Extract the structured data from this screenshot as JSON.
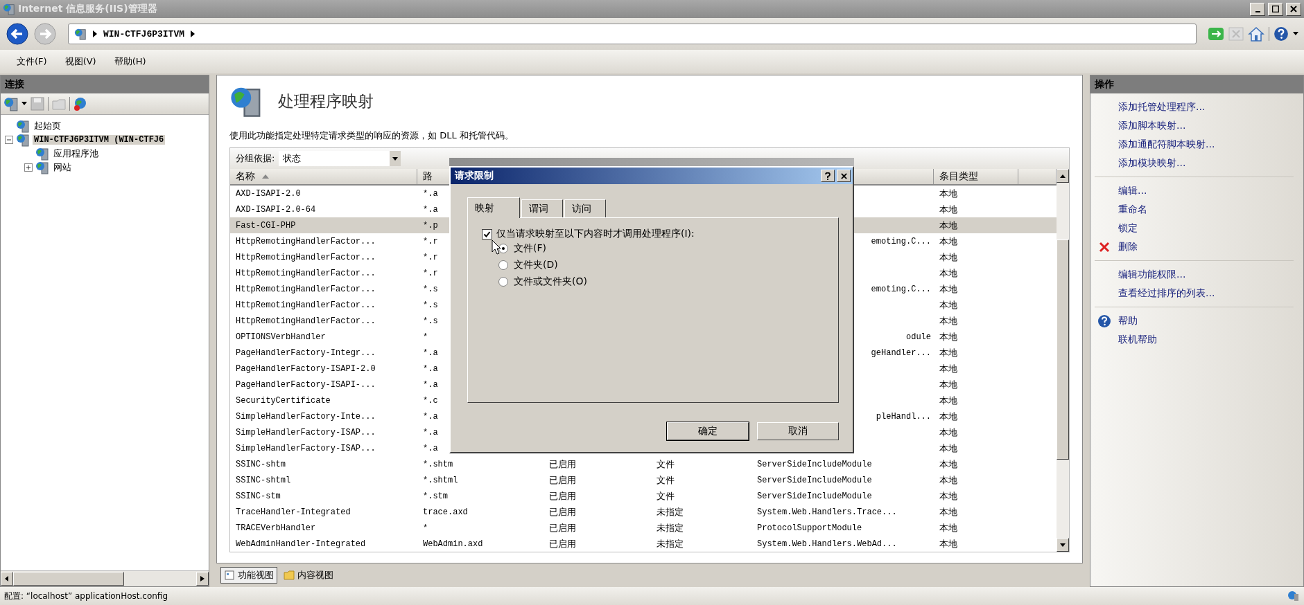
{
  "window": {
    "title": "Internet 信息服务(IIS)管理器"
  },
  "address_bar": {
    "segments": [
      "WIN-CTFJ6P3ITVM"
    ]
  },
  "menu": [
    "文件(F)",
    "视图(V)",
    "帮助(H)"
  ],
  "connections": {
    "title": "连接",
    "tree": [
      {
        "label": "起始页",
        "selected": false
      },
      {
        "label": "WIN-CTFJ6P3ITVM (WIN-CTFJ6",
        "selected": true,
        "expanded": true,
        "children": [
          {
            "label": "应用程序池",
            "selected": false
          },
          {
            "label": "网站",
            "selected": false,
            "expanded": false
          }
        ]
      }
    ]
  },
  "feature": {
    "title": "处理程序映射",
    "description": "使用此功能指定处理特定请求类型的响应的资源，如 DLL 和托管代码。",
    "group_by": {
      "label": "分组依据:",
      "value": "状态"
    }
  },
  "table": {
    "columns": {
      "name": {
        "label": "名称",
        "sorted": true
      },
      "path": {
        "label": "路"
      },
      "entry_type": {
        "label": "条目类型"
      }
    },
    "rows": [
      {
        "kind": "covered",
        "selected": false,
        "name": "AXD-ISAPI-2.0",
        "path": "*.a",
        "entry_type": "本地"
      },
      {
        "kind": "covered",
        "selected": false,
        "name": "AXD-ISAPI-2.0-64",
        "path": "*.a",
        "entry_type": "本地"
      },
      {
        "kind": "covered",
        "selected": true,
        "name": "Fast-CGI-PHP",
        "path": "*.p",
        "entry_type": "本地"
      },
      {
        "kind": "covered",
        "selected": false,
        "name": "HttpRemotingHandlerFactor...",
        "path": "*.r",
        "handler": "emoting.C...",
        "entry_type": "本地"
      },
      {
        "kind": "covered",
        "selected": false,
        "name": "HttpRemotingHandlerFactor...",
        "path": "*.r",
        "entry_type": "本地"
      },
      {
        "kind": "covered",
        "selected": false,
        "name": "HttpRemotingHandlerFactor...",
        "path": "*.r",
        "entry_type": "本地"
      },
      {
        "kind": "covered",
        "selected": false,
        "name": "HttpRemotingHandlerFactor...",
        "path": "*.s",
        "handler": "emoting.C...",
        "entry_type": "本地"
      },
      {
        "kind": "covered",
        "selected": false,
        "name": "HttpRemotingHandlerFactor...",
        "path": "*.s",
        "entry_type": "本地"
      },
      {
        "kind": "covered",
        "selected": false,
        "name": "HttpRemotingHandlerFactor...",
        "path": "*.s",
        "entry_type": "本地"
      },
      {
        "kind": "covered",
        "selected": false,
        "name": "OPTIONSVerbHandler",
        "path": "*",
        "handler": "odule",
        "entry_type": "本地"
      },
      {
        "kind": "covered",
        "selected": false,
        "name": "PageHandlerFactory-Integr...",
        "path": "*.a",
        "handler": "geHandler...",
        "entry_type": "本地"
      },
      {
        "kind": "covered",
        "selected": false,
        "name": "PageHandlerFactory-ISAPI-2.0",
        "path": "*.a",
        "entry_type": "本地"
      },
      {
        "kind": "covered",
        "selected": false,
        "name": "PageHandlerFactory-ISAPI-...",
        "path": "*.a",
        "entry_type": "本地"
      },
      {
        "kind": "covered",
        "selected": false,
        "name": "SecurityCertificate",
        "path": "*.c",
        "entry_type": "本地"
      },
      {
        "kind": "covered",
        "selected": false,
        "name": "SimpleHandlerFactory-Inte...",
        "path": "*.a",
        "handler": "pleHandl...",
        "entry_type": "本地"
      },
      {
        "kind": "covered",
        "selected": false,
        "name": "SimpleHandlerFactory-ISAP...",
        "path": "*.a",
        "entry_type": "本地"
      },
      {
        "kind": "covered",
        "selected": false,
        "name": "SimpleHandlerFactory-ISAP...",
        "path": "*.a",
        "entry_type": "本地"
      },
      {
        "kind": "full",
        "selected": false,
        "name": "SSINC-shtm",
        "path": "*.shtm",
        "status": "已启用",
        "path_type": "文件",
        "handler": "ServerSideIncludeModule",
        "entry_type": "本地"
      },
      {
        "kind": "full",
        "selected": false,
        "name": "SSINC-shtml",
        "path": "*.shtml",
        "status": "已启用",
        "path_type": "文件",
        "handler": "ServerSideIncludeModule",
        "entry_type": "本地"
      },
      {
        "kind": "full",
        "selected": false,
        "name": "SSINC-stm",
        "path": "*.stm",
        "status": "已启用",
        "path_type": "文件",
        "handler": "ServerSideIncludeModule",
        "entry_type": "本地"
      },
      {
        "kind": "full",
        "selected": false,
        "name": "TraceHandler-Integrated",
        "path": "trace.axd",
        "status": "已启用",
        "path_type": "未指定",
        "handler": "System.Web.Handlers.Trace...",
        "entry_type": "本地"
      },
      {
        "kind": "full",
        "selected": false,
        "name": "TRACEVerbHandler",
        "path": "*",
        "status": "已启用",
        "path_type": "未指定",
        "handler": "ProtocolSupportModule",
        "entry_type": "本地"
      },
      {
        "kind": "full",
        "selected": false,
        "name": "WebAdminHandler-Integrated",
        "path": "WebAdmin.axd",
        "status": "已启用",
        "path_type": "未指定",
        "handler": "System.Web.Handlers.WebAd...",
        "entry_type": "本地"
      }
    ]
  },
  "views": [
    {
      "label": "功能视图",
      "selected": true
    },
    {
      "label": "内容视图",
      "selected": false
    }
  ],
  "actions": {
    "title": "操作",
    "groups": [
      [
        {
          "label": "添加托管处理程序...",
          "kind": "plain"
        },
        {
          "label": "添加脚本映射...",
          "kind": "plain"
        },
        {
          "label": "添加通配符脚本映射...",
          "kind": "plain"
        },
        {
          "label": "添加模块映射...",
          "kind": "plain"
        }
      ],
      [
        {
          "label": "编辑...",
          "kind": "plain"
        },
        {
          "label": "重命名",
          "kind": "plain"
        },
        {
          "label": "锁定",
          "kind": "plain"
        },
        {
          "label": "删除",
          "kind": "delete"
        }
      ],
      [
        {
          "label": "编辑功能权限...",
          "kind": "plain"
        },
        {
          "label": "查看经过排序的列表...",
          "kind": "plain"
        }
      ],
      [
        {
          "label": "帮助",
          "kind": "help"
        },
        {
          "label": "联机帮助",
          "kind": "plain"
        }
      ]
    ]
  },
  "dialog": {
    "title": "请求限制",
    "tabs": [
      {
        "label": "映射",
        "selected": true
      },
      {
        "label": "谓词",
        "selected": false
      },
      {
        "label": "访问",
        "selected": false
      }
    ],
    "checkbox": {
      "label": "仅当请求映射至以下内容时才调用处理程序(I):",
      "checked": true
    },
    "radios": [
      {
        "label": "文件(F)",
        "selected": true
      },
      {
        "label": "文件夹(D)",
        "selected": false
      },
      {
        "label": "文件或文件夹(O)",
        "selected": false
      }
    ],
    "buttons": [
      "确定",
      "取消"
    ]
  },
  "status_bar": {
    "text": "配置: “localhost” applicationHost.config"
  }
}
